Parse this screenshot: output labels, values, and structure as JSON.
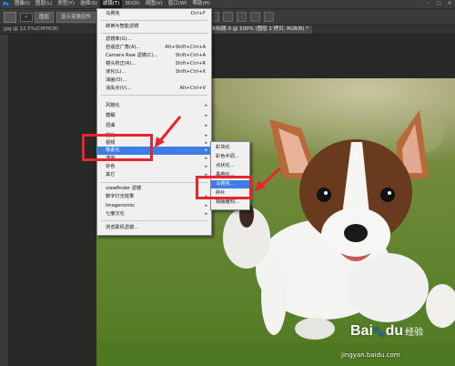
{
  "menubar": {
    "items": [
      "图像(I)",
      "图层(L)",
      "类型(Y)",
      "选择(S)",
      "滤镜(T)",
      "3D(D)",
      "视图(V)",
      "窗口(W)",
      "帮助(H)"
    ],
    "active_index": 4
  },
  "options": {
    "tool_label": "图层",
    "align_label": "显示变换控件",
    "checkbox_mark": "✓"
  },
  "tabs": {
    "left": "jpg @ 12.5%(CMYK/8)",
    "right": "未标题-3 @ 100% (图层 1 拷贝, RGB/8) *"
  },
  "filter_menu": {
    "rows": [
      {
        "label": "马赛克",
        "shortcut": "Ctrl+F",
        "arrow": ""
      },
      {
        "label": "转换为智能滤镜",
        "shortcut": "",
        "arrow": ""
      },
      {
        "label": "滤镜库(G)...",
        "shortcut": "",
        "arrow": ""
      },
      {
        "label": "自适应广角(A)...",
        "shortcut": "Alt+Shift+Ctrl+A",
        "arrow": ""
      },
      {
        "label": "Camera Raw 滤镜(C)...",
        "shortcut": "Shift+Ctrl+A",
        "arrow": ""
      },
      {
        "label": "镜头校正(R)...",
        "shortcut": "Shift+Ctrl+R",
        "arrow": ""
      },
      {
        "label": "液化(L)...",
        "shortcut": "Shift+Ctrl+X",
        "arrow": ""
      },
      {
        "label": "油画(O)...",
        "shortcut": "",
        "arrow": ""
      },
      {
        "label": "消失点(V)...",
        "shortcut": "Alt+Ctrl+V",
        "arrow": ""
      },
      {
        "label": "风格化",
        "shortcut": "",
        "arrow": "▸"
      },
      {
        "label": "模糊",
        "shortcut": "",
        "arrow": "▸"
      },
      {
        "label": "扭曲",
        "shortcut": "",
        "arrow": "▸"
      },
      {
        "label": "锐化",
        "shortcut": "",
        "arrow": "▸"
      },
      {
        "label": "视频",
        "shortcut": "",
        "arrow": "▸"
      },
      {
        "label": "像素化",
        "shortcut": "",
        "arrow": "▸"
      },
      {
        "label": "渲染",
        "shortcut": "",
        "arrow": "▸"
      },
      {
        "label": "杂色",
        "shortcut": "",
        "arrow": "▸"
      },
      {
        "label": "其它",
        "shortcut": "",
        "arrow": "▸"
      },
      {
        "label": "viewfinder 滤镜",
        "shortcut": "",
        "arrow": ""
      },
      {
        "label": "数字灯光效果",
        "shortcut": "",
        "arrow": "▸"
      },
      {
        "label": "Imagenomic",
        "shortcut": "",
        "arrow": "▸"
      },
      {
        "label": "七度汉化",
        "shortcut": "",
        "arrow": "▸"
      },
      {
        "label": "浏览联机滤镜...",
        "shortcut": "",
        "arrow": ""
      }
    ],
    "highlighted_index": 14
  },
  "pixelate_submenu": {
    "rows": [
      "彩块化",
      "彩色半调...",
      "点状化...",
      "晶格化...",
      "马赛克...",
      "碎片",
      "铜版雕刻..."
    ],
    "highlighted_index": 4
  },
  "watermark": {
    "logo": "Bai",
    "logo_tail": "du",
    "brand": "经验",
    "url": "jingyan.baidu.com"
  },
  "colors": {
    "highlight": "#3d7ee6",
    "annotation_red": "#e8242c"
  }
}
